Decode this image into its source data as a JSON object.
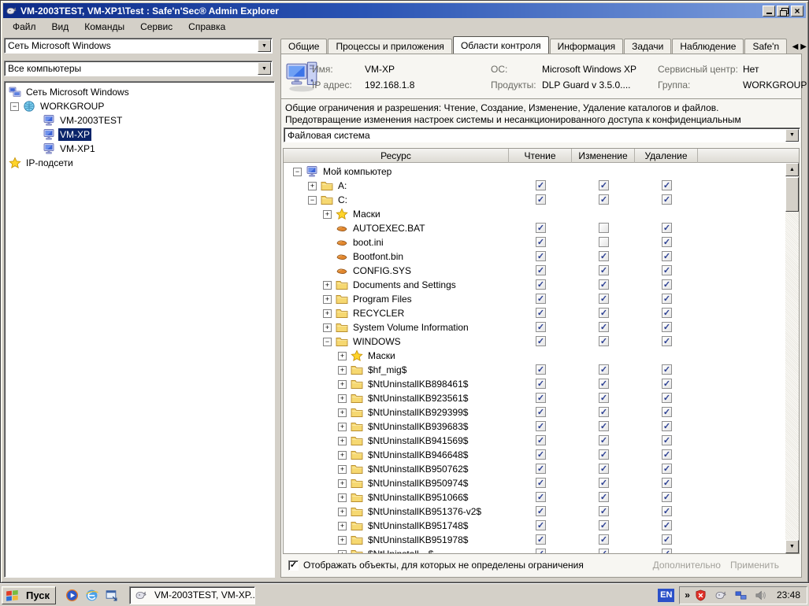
{
  "window": {
    "title": "VM-2003TEST, VM-XP1\\Test : Safe'n'Sec® Admin Explorer",
    "menu": [
      "Файл",
      "Вид",
      "Команды",
      "Сервис",
      "Справка"
    ]
  },
  "left_panel": {
    "network_combo": "Сеть Microsoft Windows",
    "computers_combo": "Все компьютеры",
    "tree": [
      {
        "label": "Сеть Microsoft Windows",
        "icon": "network",
        "level": 0,
        "expander": null,
        "selected": false
      },
      {
        "label": "WORKGROUP",
        "icon": "domain",
        "level": 1,
        "expander": "minus",
        "selected": false
      },
      {
        "label": "VM-2003TEST",
        "icon": "computer",
        "level": 2,
        "expander": null,
        "selected": false
      },
      {
        "label": "VM-XP",
        "icon": "computer",
        "level": 2,
        "expander": null,
        "selected": true
      },
      {
        "label": "VM-XP1",
        "icon": "computer",
        "level": 2,
        "expander": null,
        "selected": false
      },
      {
        "label": "IP-подсети",
        "icon": "star",
        "level": 0,
        "expander": null,
        "selected": false
      }
    ]
  },
  "tabs": {
    "items": [
      {
        "label": "Общие",
        "active": false
      },
      {
        "label": "Процессы и приложения",
        "active": false
      },
      {
        "label": "Области контроля",
        "active": true
      },
      {
        "label": "Информация",
        "active": false
      },
      {
        "label": "Задачи",
        "active": false
      },
      {
        "label": "Наблюдение",
        "active": false
      },
      {
        "label": "Safe'n",
        "active": false
      }
    ]
  },
  "info": {
    "columns": [
      [
        {
          "label": "Имя:",
          "value": "VM-XP"
        },
        {
          "label": "IP адрес:",
          "value": "192.168.1.8"
        }
      ],
      [
        {
          "label": "ОС:",
          "value": "Microsoft Windows XP"
        },
        {
          "label": "Продукты:",
          "value": "DLP Guard v 3.5.0...."
        }
      ],
      [
        {
          "label": "Сервисный центр:",
          "value": "Нет"
        },
        {
          "label": "Группа:",
          "value": "WORKGROUP"
        }
      ]
    ]
  },
  "description": {
    "line1": "Общие ограничения и разрешения: Чтение, Создание, Изменение, Удаление каталогов и файлов.",
    "line2": "Предотвращение изменения настроек системы и несанкционированного доступа к конфиденциальным"
  },
  "scope_combo": "Файловая система",
  "table": {
    "columns": [
      "Ресурс",
      "Чтение",
      "Изменение",
      "Удаление"
    ],
    "rows": [
      {
        "label": "Мой компьютер",
        "icon": "computer",
        "level": 0,
        "expander": "minus",
        "checks": null
      },
      {
        "label": "A:",
        "icon": "folder",
        "level": 1,
        "expander": "plus",
        "checks": [
          true,
          true,
          true
        ]
      },
      {
        "label": "C:",
        "icon": "folder",
        "level": 1,
        "expander": "minus",
        "checks": [
          true,
          true,
          true
        ]
      },
      {
        "label": "Маски",
        "icon": "star",
        "level": 2,
        "expander": "plus",
        "checks": null
      },
      {
        "label": "AUTOEXEC.BAT",
        "icon": "file",
        "level": 2,
        "expander": null,
        "checks": [
          true,
          false,
          true
        ]
      },
      {
        "label": "boot.ini",
        "icon": "file",
        "level": 2,
        "expander": null,
        "checks": [
          true,
          false,
          true
        ]
      },
      {
        "label": "Bootfont.bin",
        "icon": "file",
        "level": 2,
        "expander": null,
        "checks": [
          true,
          true,
          true
        ]
      },
      {
        "label": "CONFIG.SYS",
        "icon": "file",
        "level": 2,
        "expander": null,
        "checks": [
          true,
          true,
          true
        ]
      },
      {
        "label": "Documents and Settings",
        "icon": "folder",
        "level": 2,
        "expander": "plus",
        "checks": [
          true,
          true,
          true
        ]
      },
      {
        "label": "Program Files",
        "icon": "folder",
        "level": 2,
        "expander": "plus",
        "checks": [
          true,
          true,
          true
        ]
      },
      {
        "label": "RECYCLER",
        "icon": "folder",
        "level": 2,
        "expander": "plus",
        "checks": [
          true,
          true,
          true
        ]
      },
      {
        "label": "System Volume Information",
        "icon": "folder",
        "level": 2,
        "expander": "plus",
        "checks": [
          true,
          true,
          true
        ]
      },
      {
        "label": "WINDOWS",
        "icon": "folder",
        "level": 2,
        "expander": "minus",
        "checks": [
          true,
          true,
          true
        ]
      },
      {
        "label": "Маски",
        "icon": "star",
        "level": 3,
        "expander": "plus",
        "checks": null
      },
      {
        "label": "$hf_mig$",
        "icon": "folder",
        "level": 3,
        "expander": "plus",
        "checks": [
          true,
          true,
          true
        ]
      },
      {
        "label": "$NtUninstallKB898461$",
        "icon": "folder",
        "level": 3,
        "expander": "plus",
        "checks": [
          true,
          true,
          true
        ]
      },
      {
        "label": "$NtUninstallKB923561$",
        "icon": "folder",
        "level": 3,
        "expander": "plus",
        "checks": [
          true,
          true,
          true
        ]
      },
      {
        "label": "$NtUninstallKB929399$",
        "icon": "folder",
        "level": 3,
        "expander": "plus",
        "checks": [
          true,
          true,
          true
        ]
      },
      {
        "label": "$NtUninstallKB939683$",
        "icon": "folder",
        "level": 3,
        "expander": "plus",
        "checks": [
          true,
          true,
          true
        ]
      },
      {
        "label": "$NtUninstallKB941569$",
        "icon": "folder",
        "level": 3,
        "expander": "plus",
        "checks": [
          true,
          true,
          true
        ]
      },
      {
        "label": "$NtUninstallKB946648$",
        "icon": "folder",
        "level": 3,
        "expander": "plus",
        "checks": [
          true,
          true,
          true
        ]
      },
      {
        "label": "$NtUninstallKB950762$",
        "icon": "folder",
        "level": 3,
        "expander": "plus",
        "checks": [
          true,
          true,
          true
        ]
      },
      {
        "label": "$NtUninstallKB950974$",
        "icon": "folder",
        "level": 3,
        "expander": "plus",
        "checks": [
          true,
          true,
          true
        ]
      },
      {
        "label": "$NtUninstallKB951066$",
        "icon": "folder",
        "level": 3,
        "expander": "plus",
        "checks": [
          true,
          true,
          true
        ]
      },
      {
        "label": "$NtUninstallKB951376-v2$",
        "icon": "folder",
        "level": 3,
        "expander": "plus",
        "checks": [
          true,
          true,
          true
        ]
      },
      {
        "label": "$NtUninstallKB951748$",
        "icon": "folder",
        "level": 3,
        "expander": "plus",
        "checks": [
          true,
          true,
          true
        ]
      },
      {
        "label": "$NtUninstallKB951978$",
        "icon": "folder",
        "level": 3,
        "expander": "plus",
        "checks": [
          true,
          true,
          true
        ]
      },
      {
        "label": "$NtUninstall…$",
        "icon": "folder",
        "level": 3,
        "expander": "plus",
        "checks": [
          true,
          true,
          true
        ]
      }
    ]
  },
  "footer": {
    "checkbox_label": "Отображать объекты, для которых не определены ограничения",
    "checkbox_checked": true,
    "advanced_label": "Дополнительно",
    "apply_label": "Применить"
  },
  "taskbar": {
    "start_label": "Пуск",
    "task_label": "VM-2003TEST, VM-XP...",
    "language": "EN",
    "time": "23:48"
  },
  "colors": {
    "titlebar_left": "#0D2B87",
    "titlebar_right": "#7E9FDD",
    "chrome": "#D4D0C8",
    "selection": "#0A246A",
    "check": "#2B3F92"
  }
}
